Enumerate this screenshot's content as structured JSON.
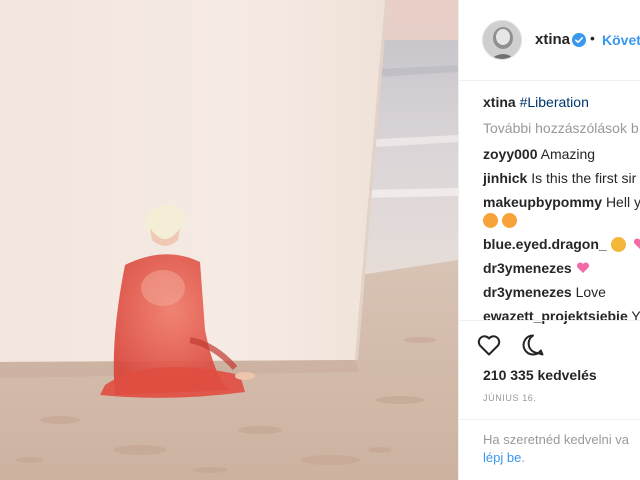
{
  "post": {
    "username": "xtina",
    "follow_label": "Követ",
    "separator": "•",
    "caption_user": "xtina",
    "caption_text": "#Liberation",
    "more_comments": "További hozzászólások b",
    "likes": "210 335 kedvelés",
    "date": "JÚNIUS 16.",
    "login_prompt": "Ha szeretnéd kedvelni va",
    "login_link": "lépj be",
    "login_period": "."
  },
  "comments": [
    {
      "user": "zoyy000",
      "text": "Amazing"
    },
    {
      "user": "jinhick",
      "text": "Is this the first sir"
    },
    {
      "user": "makeupbypommy",
      "text": "Hell y"
    },
    {
      "user": "blue.eyed.dragon_",
      "text": ""
    },
    {
      "user": "dr3ymenezes",
      "text": ""
    },
    {
      "user": "dr3ymenezes",
      "text": "Love"
    },
    {
      "user": "ewazett_projektsiebie",
      "text": "Y"
    }
  ],
  "colors": {
    "link_blue": "#3897f0",
    "hashtag": "#003569",
    "text": "#262626",
    "muted": "#999999",
    "dress": "#e8584a"
  },
  "icons": {
    "verified": "verified-badge-icon",
    "like": "heart-outline-icon",
    "comment": "comment-bubble-icon"
  }
}
